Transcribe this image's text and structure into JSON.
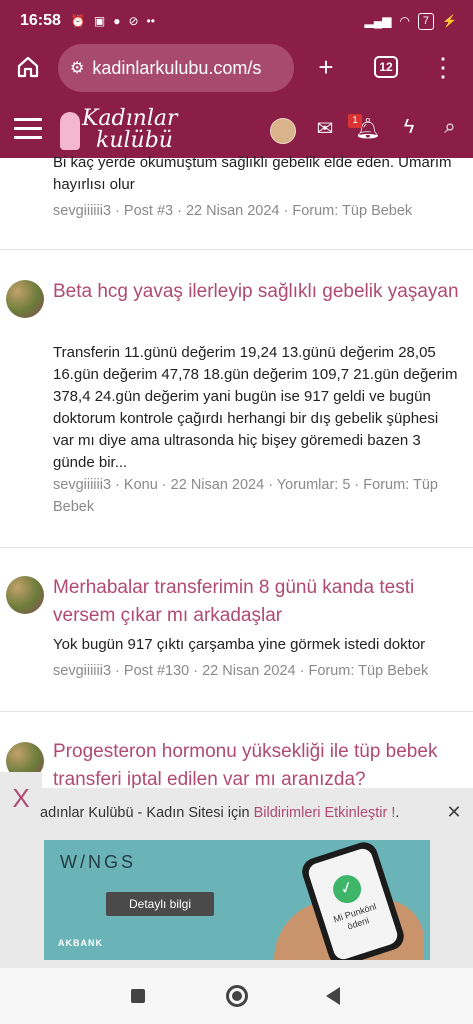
{
  "status_bar": {
    "time": "16:58",
    "battery": "7"
  },
  "browser": {
    "url": "kadinlarkulubu.com/s",
    "tab_count": "12",
    "url_bg": "#a84a6c"
  },
  "site": {
    "logo_line1": "Kadınlar",
    "logo_line2": "kulübü",
    "notifications_count": "1",
    "brand_color": "#8b1e46",
    "link_color": "#b04a72"
  },
  "results": [
    {
      "title": "",
      "snippet": "Bi kaç yerde okumuştum sağlıklı gebelik elde eden. Umarım hayırlısı olur",
      "meta": "sevgiiiiii3 · Post #3 · 22 Nisan 2024 · Forum: Tüp Bebek"
    },
    {
      "title": "Beta hcg yavaş ilerleyip sağlıklı gebelik yaşayan",
      "snippet": "Transferin 11.günü değerim 19,24 13.günü değerim 28,05 16.gün değerim 47,78 18.gün değerim 109,7 21.gün değerim 378,4 24.gün değerim yani bugün ise 917 geldi ve bugün doktorum kontrole çağırdı herhangi bir dış gebelik şüphesi var mı diye ama ultrasonda hiç bişey göremedi bazen 3 günde bir...",
      "meta": "sevgiiiiii3 · Konu · 22 Nisan 2024 · Yorumlar: 5 · Forum: Tüp Bebek"
    },
    {
      "title": "Merhabalar transferimin 8 günü kanda testi versem çıkar mı arkadaşlar",
      "snippet": "Yok bugün 917 çıktı çarşamba yine görmek istedi doktor",
      "meta": "sevgiiiiii3 · Post #130 · 22 Nisan 2024 · Forum: Tüp Bebek"
    },
    {
      "title": "Progesteron hormonu yüksekliği ile tüp bebek transferi iptal edilen var mı aranızda?",
      "snippet": "",
      "meta": ""
    }
  ],
  "notification": {
    "x_label": "X",
    "text": "adınlar Kulübü - Kadın Sitesi için ",
    "link": "Bildirimleri Etkinleştir !",
    "suffix": ".",
    "close": "✕"
  },
  "ad": {
    "brand": "W/NGS",
    "button": "Detaylı bilgi",
    "bank": "AKBANK",
    "screen_text": "Mi Punkönl ödeni"
  }
}
